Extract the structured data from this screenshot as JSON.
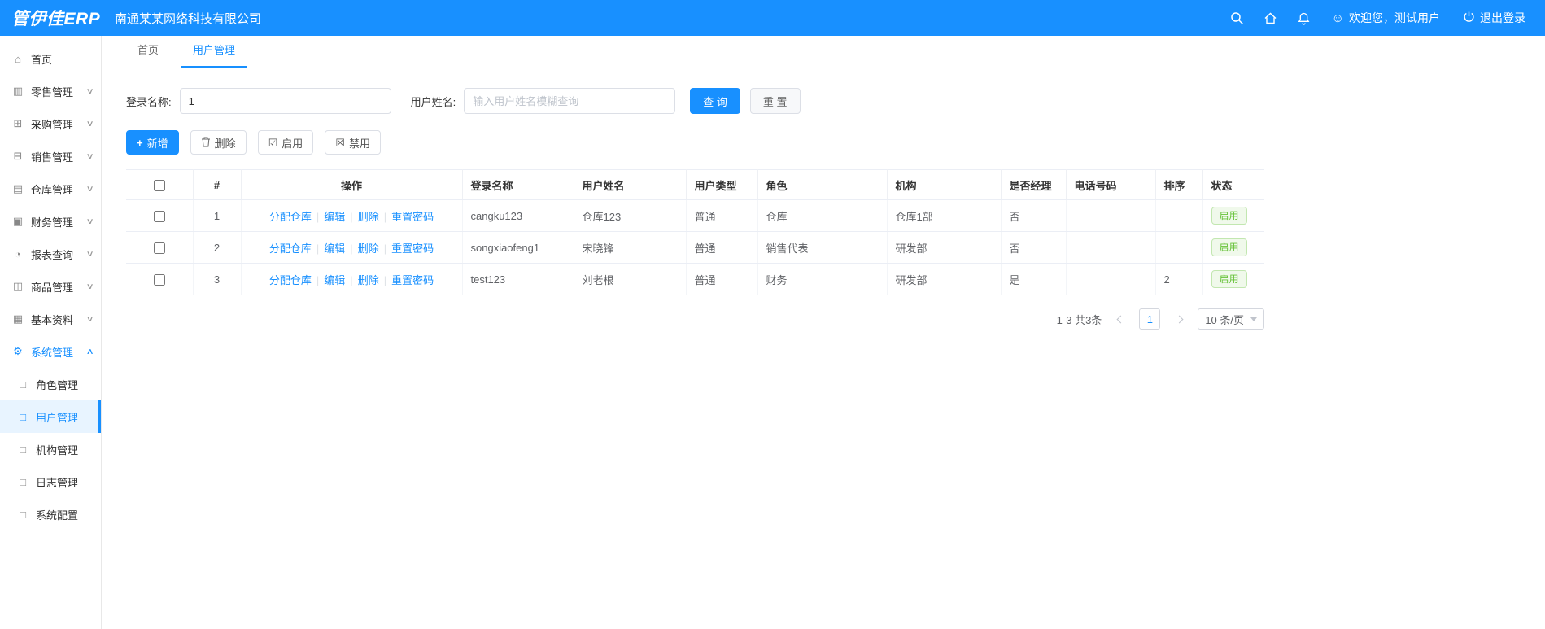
{
  "header": {
    "logo": "管伊佳ERP",
    "company": "南通某某网络科技有限公司",
    "welcome": "欢迎您，测试用户",
    "logout": "退出登录"
  },
  "icons": {
    "home": "⌂",
    "retail": "▥",
    "purchase": "⊞",
    "sales": "⊟",
    "warehouse": "▤",
    "finance": "▣",
    "report": "◔",
    "goods": "◫",
    "basedata": "▦",
    "system": "⚙",
    "doc": "□",
    "chevron_down": "∨",
    "chevron_up": "∧",
    "plus": "+",
    "enable": "☑",
    "disable": "☒",
    "smiley": "☺"
  },
  "sidebar": {
    "items": [
      {
        "label": "首页"
      },
      {
        "label": "零售管理"
      },
      {
        "label": "采购管理"
      },
      {
        "label": "销售管理"
      },
      {
        "label": "仓库管理"
      },
      {
        "label": "财务管理"
      },
      {
        "label": "报表查询"
      },
      {
        "label": "商品管理"
      },
      {
        "label": "基本资料"
      },
      {
        "label": "系统管理"
      }
    ],
    "system_subitems": [
      {
        "label": "角色管理"
      },
      {
        "label": "用户管理"
      },
      {
        "label": "机构管理"
      },
      {
        "label": "日志管理"
      },
      {
        "label": "系统配置"
      }
    ]
  },
  "tabs": [
    {
      "label": "首页"
    },
    {
      "label": "用户管理"
    }
  ],
  "filter": {
    "login_name_label": "登录名称:",
    "login_name_value": "1",
    "user_name_label": "用户姓名:",
    "user_name_placeholder": "输入用户姓名模糊查询",
    "search_button": "查 询",
    "reset_button": "重 置"
  },
  "toolbar": {
    "add": "新增",
    "delete": "删除",
    "enable": "启用",
    "disable": "禁用"
  },
  "table": {
    "headers": [
      "#",
      "操作",
      "登录名称",
      "用户姓名",
      "用户类型",
      "角色",
      "机构",
      "是否经理",
      "电话号码",
      "排序",
      "状态"
    ],
    "action_links": [
      "分配仓库",
      "编辑",
      "删除",
      "重置密码"
    ],
    "rows": [
      {
        "index": "1",
        "login": "cangku123",
        "name": "仓库123",
        "type": "普通",
        "role": "仓库",
        "org": "仓库1部",
        "manager": "否",
        "phone": "",
        "sort": "",
        "status": "启用"
      },
      {
        "index": "2",
        "login": "songxiaofeng1",
        "name": "宋晓锋",
        "type": "普通",
        "role": "销售代表",
        "org": "研发部",
        "manager": "否",
        "phone": "",
        "sort": "",
        "status": "启用"
      },
      {
        "index": "3",
        "login": "test123",
        "name": "刘老根",
        "type": "普通",
        "role": "财务",
        "org": "研发部",
        "manager": "是",
        "phone": "",
        "sort": "2",
        "status": "启用"
      }
    ]
  },
  "pagination": {
    "total_text": "1-3 共3条",
    "page": "1",
    "page_size": "10 条/页"
  }
}
